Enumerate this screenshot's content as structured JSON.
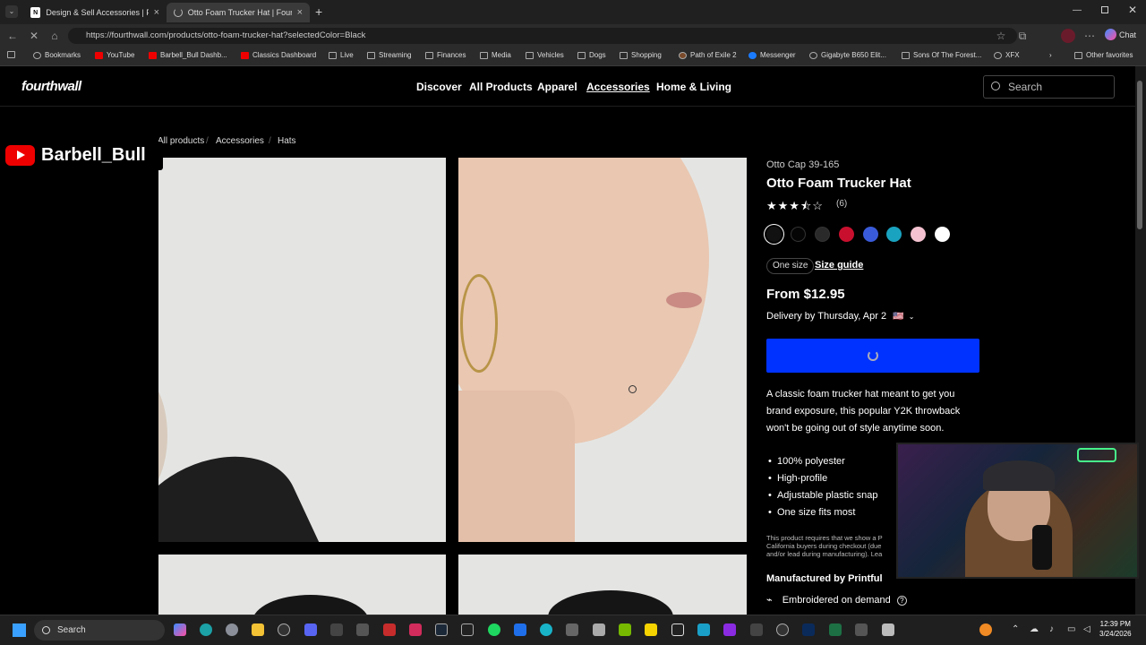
{
  "browser": {
    "tabs": [
      {
        "title": "Design & Sell Accessories | Fourth",
        "fav": "N"
      },
      {
        "title": "Otto Foam Trucker Hat | Fourthwal",
        "fav": ""
      }
    ],
    "new_tab": "+",
    "url": "https://fourthwall.com/products/otto-foam-trucker-hat?selectedColor=Black",
    "chat_label": "Chat",
    "bookmarks": [
      "Bookmarks",
      "YouTube",
      "Barbell_Bull Dashb...",
      "Classics Dashboard",
      "Live",
      "Streaming",
      "Finances",
      "Media",
      "Vehicles",
      "Dogs",
      "Shopping",
      "Path of Exile 2",
      "Messenger",
      "Gigabyte B650 Elit...",
      "Sons Of The Forest...",
      "XFX"
    ],
    "other_favorites": "Other favorites"
  },
  "site": {
    "logo": "fourthwall",
    "nav": [
      "Discover",
      "All Products",
      "Apparel",
      "Accessories",
      "Home & Living"
    ],
    "active_nav": "Accessories",
    "search_placeholder": "Search",
    "breadcrumbs": [
      "All products",
      "Accessories",
      "Hats"
    ]
  },
  "product": {
    "model": "Otto Cap 39-165",
    "title": "Otto Foam Trucker Hat",
    "rating": 3.5,
    "stars_text": "★★★⯪☆",
    "review_count": "(6)",
    "swatches": [
      "#111111",
      "#050505",
      "#2a2a2a",
      "#c8102e",
      "#3a5bd9",
      "#1aa3c0",
      "#f4c2d0",
      "#ffffff"
    ],
    "selected_swatch": 0,
    "size": "One size",
    "size_guide": "Size guide",
    "price": "From $12.95",
    "delivery": "Delivery by Thursday, Apr 2",
    "flag": "🇺🇸",
    "description": [
      "A classic foam trucker hat meant to get you",
      "brand exposure, this popular Y2K throwback",
      "won't be going out of style anytime soon."
    ],
    "bullets": [
      "100% polyester",
      "High-profile",
      "Adjustable plastic snap",
      "One size fits most"
    ],
    "fine_print": [
      "This product requires that we show a P",
      "California buyers during checkout (due",
      "and/or lead during manufacturing). Lea"
    ],
    "manufacturer": "Manufactured by Printful",
    "embroidered": "Embroidered on demand"
  },
  "overlay": {
    "channel": "Barbell_Bull"
  },
  "taskbar": {
    "search": "Search",
    "time": "12:39 PM",
    "date": "3/24/2026"
  },
  "colors": {
    "accent_button": "#0032ff",
    "youtube_red": "#e00000"
  }
}
